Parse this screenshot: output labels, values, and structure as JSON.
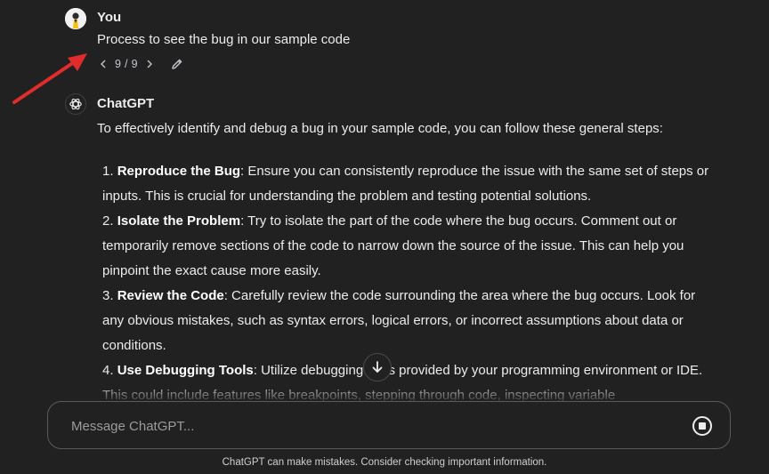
{
  "user_message": {
    "author": "You",
    "text": "Process to see the bug in our sample code",
    "pager": "9 / 9",
    "avatar_icon": "user-avatar",
    "prev_icon": "chevron-left-icon",
    "next_icon": "chevron-right-icon",
    "edit_icon": "pencil-icon"
  },
  "annotation": {
    "color": "#e22b2b",
    "icon": "red-arrow"
  },
  "assistant_message": {
    "author": "ChatGPT",
    "avatar_icon": "openai-logo-icon",
    "intro": "To effectively identify and debug a bug in your sample code, you can follow these general steps:",
    "steps": [
      {
        "num": "1.",
        "title": "Reproduce the Bug",
        "body": ": Ensure you can consistently reproduce the issue with the same set of steps or inputs. This is crucial for understanding the problem and testing potential solutions."
      },
      {
        "num": "2.",
        "title": "Isolate the Problem",
        "body": ": Try to isolate the part of the code where the bug occurs. Comment out or temporarily remove sections of the code to narrow down the source of the issue. This can help you pinpoint the exact cause more easily."
      },
      {
        "num": "3.",
        "title": "Review the Code",
        "body": ": Carefully review the code surrounding the area where the bug occurs. Look for any obvious mistakes, such as syntax errors, logical errors, or incorrect assumptions about data or conditions."
      },
      {
        "num": "4.",
        "title": "Use Debugging Tools",
        "body": ": Utilize debugging tools provided by your programming environment or IDE. This could include features like breakpoints, stepping through code, inspecting variable"
      }
    ]
  },
  "scroll_button_icon": "arrow-down-icon",
  "composer": {
    "placeholder": "Message ChatGPT...",
    "value": "",
    "stop_icon": "stop-icon"
  },
  "disclaimer": "ChatGPT can make mistakes. Consider checking important information.",
  "colors": {
    "background": "#212121",
    "text": "#ececec",
    "muted": "#9b9b9b",
    "border": "#5a5a5a"
  }
}
